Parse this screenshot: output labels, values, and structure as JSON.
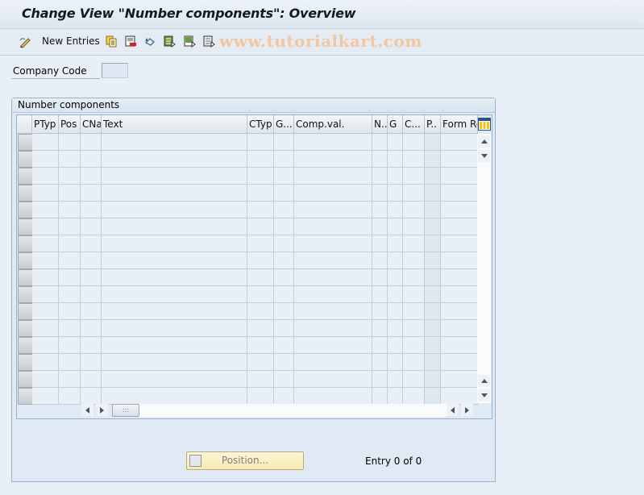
{
  "window": {
    "title": "Change View \"Number components\": Overview"
  },
  "toolbar": {
    "items": [
      {
        "icon": "edit-pencil-icon",
        "label": ""
      },
      {
        "icon": "",
        "label": "New Entries"
      },
      {
        "icon": "copy-as-icon",
        "label": ""
      },
      {
        "icon": "delete-icon",
        "label": ""
      },
      {
        "icon": "undo-change-icon",
        "label": ""
      },
      {
        "icon": "select-all-icon",
        "label": ""
      },
      {
        "icon": "select-block-icon",
        "label": ""
      },
      {
        "icon": "deselect-all-icon",
        "label": ""
      }
    ],
    "watermark": "www.tutorialkart.com"
  },
  "selection": {
    "company_code_label": "Company Code",
    "company_code_value": ""
  },
  "table": {
    "group_title": "Number components",
    "columns": [
      "PTyp",
      "Pos",
      "CNa",
      "Text",
      "CTyp",
      "G...",
      "Comp.val.",
      "N..",
      "G",
      "C...",
      "P..",
      "Form Ro"
    ],
    "row_count_visible": 16,
    "rows": []
  },
  "footer": {
    "position_button_label": "Position...",
    "entry_text": "Entry 0 of 0"
  },
  "colors": {
    "background": "#e9eff7",
    "button_bg": "#fdf6d8",
    "header_bg": "#dde6f0",
    "watermark": "#f2c49a"
  }
}
